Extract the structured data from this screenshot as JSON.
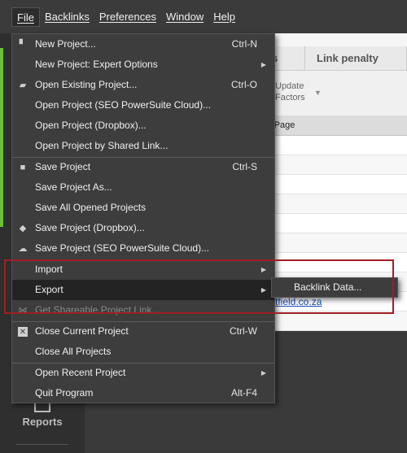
{
  "menubar": {
    "items": [
      "File",
      "Backlinks",
      "Preferences",
      "Window",
      "Help"
    ],
    "active_index": 0
  },
  "sidebar": {
    "reports_label": "Reports"
  },
  "main": {
    "tabs": [
      "s",
      "Link penalty risks"
    ],
    "update_factors_line1": "Update",
    "update_factors_line2": "Factors",
    "column_header": "nk Page",
    "visible_link": "tfield.co.za"
  },
  "file_menu": {
    "items": [
      {
        "label": "New Project...",
        "shortcut": "Ctrl-N",
        "icon": "file-icon"
      },
      {
        "label": "New Project: Expert Options",
        "submenu": true
      },
      {
        "label": "Open Existing Project...",
        "shortcut": "Ctrl-O",
        "icon": "folder-icon"
      },
      {
        "label": "Open Project (SEO PowerSuite Cloud)..."
      },
      {
        "label": "Open Project (Dropbox)..."
      },
      {
        "label": "Open Project by Shared Link..."
      },
      {
        "label": "Save Project",
        "shortcut": "Ctrl-S",
        "icon": "save-icon"
      },
      {
        "label": "Save Project As..."
      },
      {
        "label": "Save All Opened Projects"
      },
      {
        "label": "Save Project (Dropbox)...",
        "icon": "dropbox-icon"
      },
      {
        "label": "Save Project (SEO PowerSuite Cloud)...",
        "icon": "cloud-icon"
      },
      {
        "label": "Import",
        "submenu": true
      },
      {
        "label": "Export",
        "submenu": true
      },
      {
        "label": "Get Shareable Project Link...",
        "disabled": true,
        "icon": "share-icon"
      },
      {
        "label": "Close Current Project",
        "shortcut": "Ctrl-W",
        "icon": "close-icon"
      },
      {
        "label": "Close All Projects"
      },
      {
        "label": "Open Recent Project",
        "submenu": true
      },
      {
        "label": "Quit Program",
        "shortcut": "Alt-F4"
      }
    ]
  },
  "export_submenu": {
    "items": [
      "Backlink Data..."
    ]
  },
  "colors": {
    "menu_bg": "#3d3d3d",
    "hover_bg": "#232323",
    "highlight_border": "#a01e23",
    "sidebar_accent": "#6cbf3c",
    "link": "#1a4fb8"
  }
}
